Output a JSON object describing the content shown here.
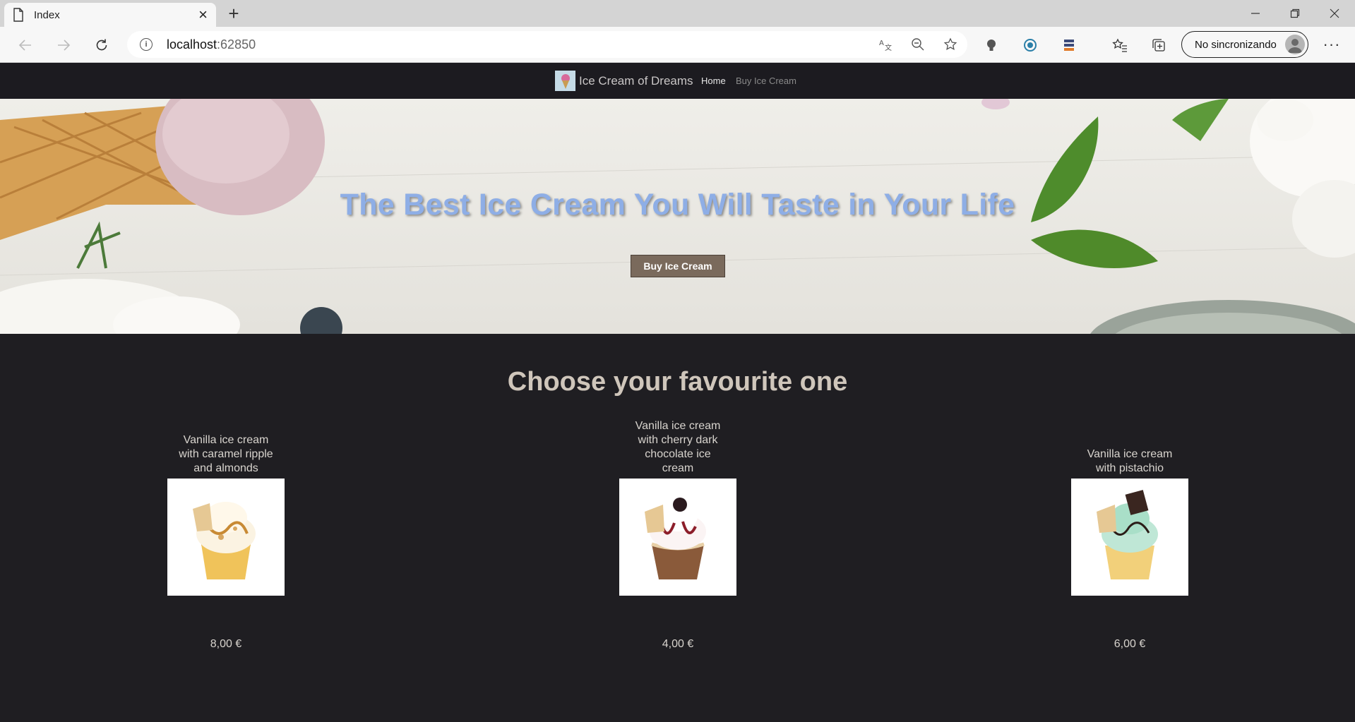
{
  "browser": {
    "tab_title": "Index",
    "url_host": "localhost",
    "url_port": ":62850",
    "sync_label": "No sincronizando"
  },
  "site": {
    "brand": "Ice Cream of Dreams",
    "nav": {
      "home": "Home",
      "buy": "Buy Ice Cream"
    },
    "hero": {
      "title": "The Best Ice Cream You Will Taste in Your Life",
      "button": "Buy Ice Cream"
    },
    "section_title": "Choose your favourite one",
    "products": [
      {
        "name": "Vanilla ice cream with caramel ripple and almonds",
        "price": "8,00 €",
        "image": "caramel-sundae"
      },
      {
        "name": "Vanilla ice cream with cherry dark chocolate ice cream",
        "price": "4,00 €",
        "image": "cherry-sundae"
      },
      {
        "name": "Vanilla ice cream with pistachio",
        "price": "6,00 €",
        "image": "pistachio-sundae"
      }
    ]
  },
  "colors": {
    "page_bg": "#1f1e22",
    "nav_bg": "#1c1b20",
    "hero_title": "#8eaee6",
    "hero_button": "#7a6a5c",
    "section_title": "#cfc6bb"
  }
}
